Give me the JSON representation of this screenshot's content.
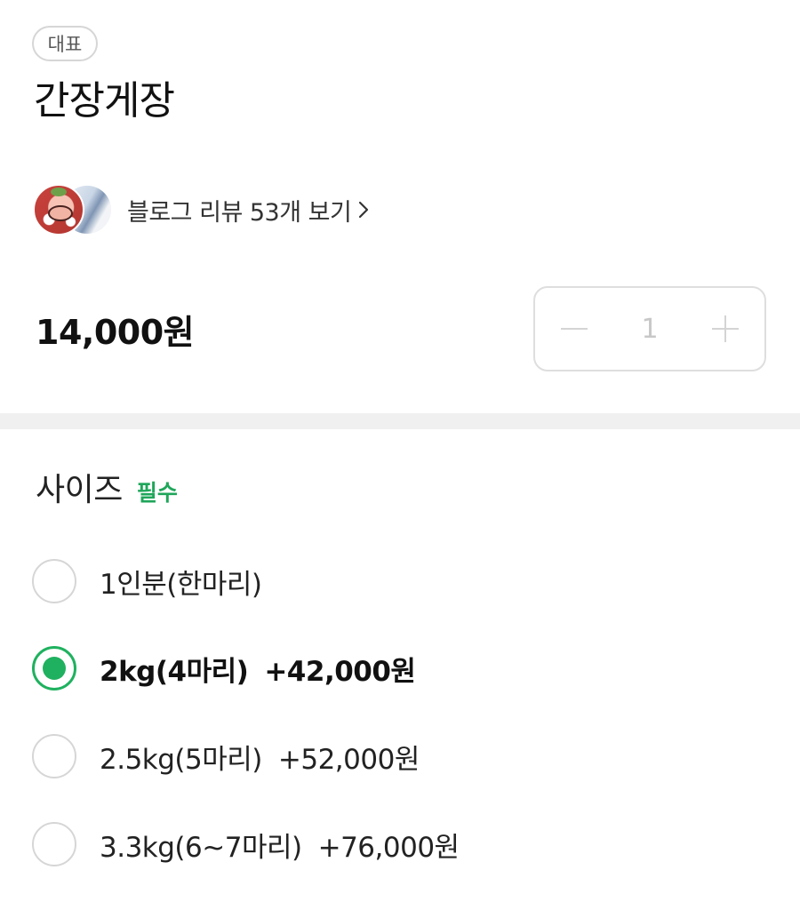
{
  "product": {
    "badge": "대표",
    "title": "간장게장",
    "review_link": "블로그 리뷰 53개 보기",
    "price": "14,000원"
  },
  "quantity": {
    "value": "1"
  },
  "size_section": {
    "title": "사이즈",
    "required_label": "필수",
    "options": [
      {
        "label": "1인분(한마리)",
        "price": "",
        "selected": false
      },
      {
        "label": "2kg(4마리)",
        "price": "+42,000원",
        "selected": true
      },
      {
        "label": "2.5kg(5마리)",
        "price": "+52,000원",
        "selected": false
      },
      {
        "label": "3.3kg(6~7마리)",
        "price": "+76,000원",
        "selected": false
      }
    ]
  },
  "colors": {
    "accent": "#1fb15f",
    "required": "#1fa65a",
    "border": "#d6d6d6",
    "divider": "#f0f0f0"
  }
}
